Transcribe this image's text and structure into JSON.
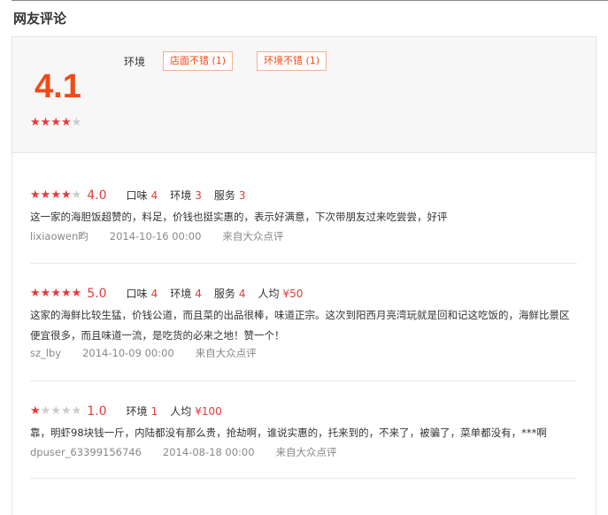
{
  "section_title": "网友评论",
  "summary": {
    "score": "4.1",
    "rating": 4,
    "tag_label": "环境",
    "tags": [
      "店面不错 (1)",
      "环境不错 (1)"
    ]
  },
  "reviews": [
    {
      "rating": 4,
      "score": "4.0",
      "dims": [
        {
          "label": "口味",
          "value": "4"
        },
        {
          "label": "环境",
          "value": "3"
        },
        {
          "label": "服务",
          "value": "3"
        }
      ],
      "text": "这一家的海胆饭超赞的，料足，价钱也挺实惠的，表示好满意，下次带朋友过来吃尝尝，好评",
      "user": "lixiaowen畇",
      "date": "2014-10-16 00:00",
      "source": "来自大众点评"
    },
    {
      "rating": 5,
      "score": "5.0",
      "dims": [
        {
          "label": "口味",
          "value": "4"
        },
        {
          "label": "环境",
          "value": "4"
        },
        {
          "label": "服务",
          "value": "4"
        },
        {
          "label": "人均",
          "value": "¥50"
        }
      ],
      "text": "这家的海鲜比较生猛，价钱公道，而且菜的出品很棒，味道正宗。这次到阳西月亮湾玩就是回和记这吃饭的，海鲜比景区便宜很多，而且味道一流，是吃货的必来之地！赞一个！",
      "user": "sz_lby",
      "date": "2014-10-09 00:00",
      "source": "来自大众点评"
    },
    {
      "rating": 1,
      "score": "1.0",
      "dims": [
        {
          "label": "环境",
          "value": "1"
        },
        {
          "label": "人均",
          "value": "¥100"
        }
      ],
      "text": "靠，明虾98块钱一斤，内陆都没有那么贵，抢劫啊，谁说实惠的，托来到的，不来了，被骗了，菜单都没有，***啊",
      "user": "dpuser_63399156746",
      "date": "2014-08-18 00:00",
      "source": "来自大众点评"
    }
  ],
  "colors": {
    "accent": "#e4393c",
    "score": "#f04a17",
    "tag_border": "#f6b08e"
  }
}
